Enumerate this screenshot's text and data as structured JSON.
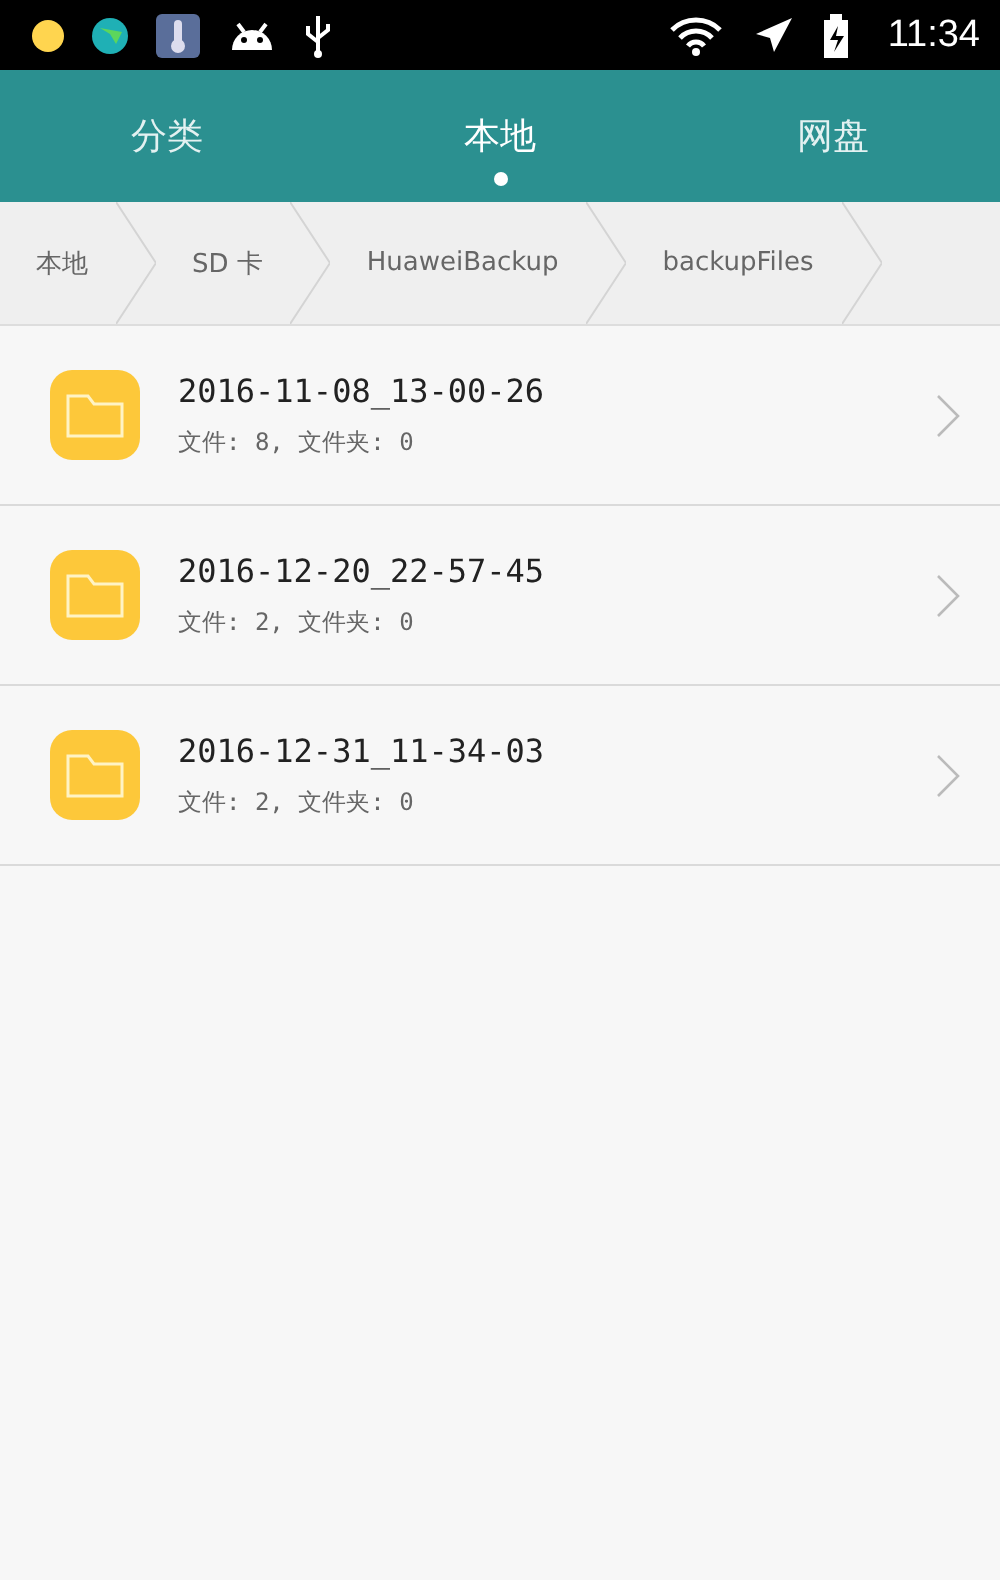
{
  "status_bar": {
    "time": "11:34"
  },
  "tabs": [
    {
      "label": "分类",
      "selected": false
    },
    {
      "label": "本地",
      "selected": true
    },
    {
      "label": "网盘",
      "selected": false
    }
  ],
  "breadcrumb": [
    "本地",
    "SD 卡",
    "HuaweiBackup",
    "backupFiles"
  ],
  "folders": [
    {
      "name": "2016-11-08_13-00-26",
      "details": "文件: 8, 文件夹: 0"
    },
    {
      "name": "2016-12-20_22-57-45",
      "details": "文件: 2, 文件夹: 0"
    },
    {
      "name": "2016-12-31_11-34-03",
      "details": "文件: 2, 文件夹: 0"
    }
  ]
}
